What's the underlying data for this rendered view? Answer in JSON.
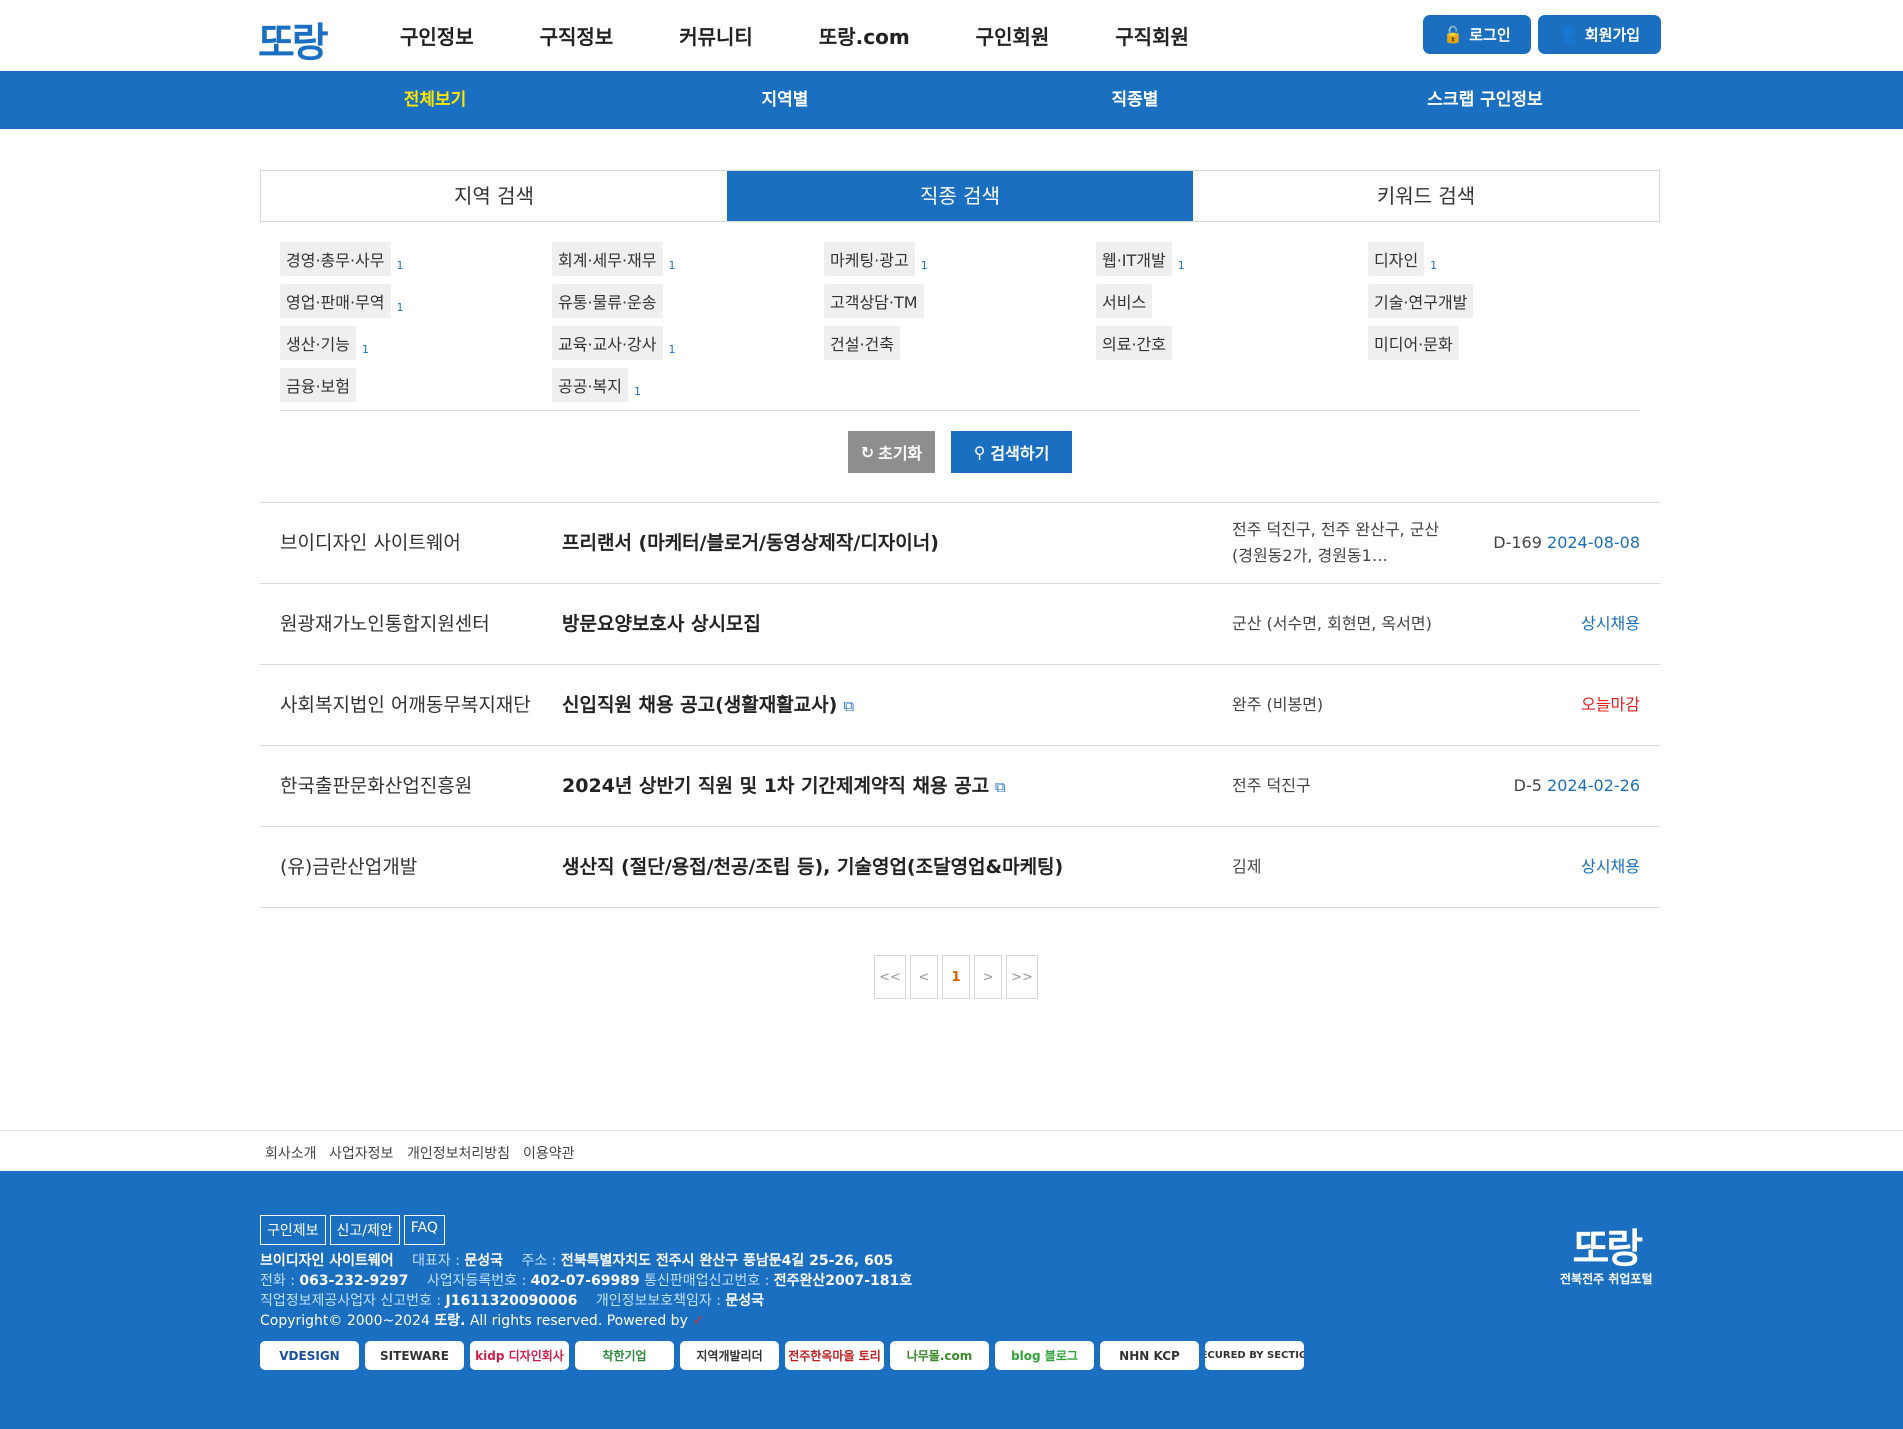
{
  "header": {
    "logo": "또랑",
    "nav": [
      "구인정보",
      "구직정보",
      "커뮤니티",
      "또랑.com",
      "구인회원",
      "구직회원"
    ],
    "login": "로그인",
    "join": "회원가입"
  },
  "subnav": [
    "전체보기",
    "지역별",
    "직종별",
    "스크랩 구인정보"
  ],
  "tabs": [
    "지역 검색",
    "직종 검색",
    "키워드 검색"
  ],
  "categories": [
    {
      "label": "경영·총무·사무",
      "count": "1"
    },
    {
      "label": "회계·세무·재무",
      "count": "1"
    },
    {
      "label": "마케팅·광고",
      "count": "1"
    },
    {
      "label": "웹·IT개발",
      "count": "1"
    },
    {
      "label": "디자인",
      "count": "1"
    },
    {
      "label": "영업·판매·무역",
      "count": "1"
    },
    {
      "label": "유통·물류·운송",
      "count": ""
    },
    {
      "label": "고객상담·TM",
      "count": ""
    },
    {
      "label": "서비스",
      "count": ""
    },
    {
      "label": "기술·연구개발",
      "count": ""
    },
    {
      "label": "생산·기능",
      "count": "1"
    },
    {
      "label": "교육·교사·강사",
      "count": "1"
    },
    {
      "label": "건설·건축",
      "count": ""
    },
    {
      "label": "의료·간호",
      "count": ""
    },
    {
      "label": "미디어·문화",
      "count": ""
    },
    {
      "label": "금융·보험",
      "count": ""
    },
    {
      "label": "공공·복지",
      "count": "1"
    }
  ],
  "buttons": {
    "reset": "초기화",
    "search": "검색하기"
  },
  "jobs": [
    {
      "company": "브이디자인 사이트웨어",
      "title": "프리랜서 (마케터/블로거/동영상제작/디자이너)",
      "location": "전주 덕진구, 전주 완산구, 군산 (경원동2가, 경원동1…",
      "dday": "D-169",
      "date": "2024-08-08",
      "status": ""
    },
    {
      "company": "원광재가노인통합지원센터",
      "title": "방문요양보호사 상시모집",
      "location": "군산 (서수면, 회현면, 옥서면)",
      "dday": "",
      "date": "",
      "status": "상시채용"
    },
    {
      "company": "사회복지법인 어깨동무복지재단",
      "title": "신입직원 채용 공고(생활재활교사)",
      "location": "완주 (비봉면)",
      "dday": "",
      "date": "",
      "status": "오늘마감"
    },
    {
      "company": "한국출판문화산업진흥원",
      "title": "2024년 상반기 직원 및 1차 기간제계약직 채용 공고",
      "location": "전주 덕진구",
      "dday": "D-5",
      "date": "2024-02-26",
      "status": ""
    },
    {
      "company": "(유)금란산업개발",
      "title": "생산직 (절단/용접/천공/조립 등), 기술영업(조달영업&마케팅)",
      "location": "김제",
      "dday": "",
      "date": "",
      "status": "상시채용"
    }
  ],
  "pagination": [
    "<<",
    "<",
    "1",
    ">",
    ">>"
  ],
  "footer_links": [
    "회사소개",
    "사업자정보",
    "개인정보처리방침",
    "이용약관"
  ],
  "footer": {
    "buttons": [
      "구인제보",
      "신고/제안",
      "FAQ"
    ],
    "company": "브이디자인 사이트웨어",
    "ceo_label": "대표자 :",
    "ceo": "문성국",
    "addr_label": "주소 :",
    "addr": "전북특별자치도 전주시 완산구 풍남문4길 25-26, 605",
    "tel_label": "전화 :",
    "tel": "063-232-9297",
    "biz_label": "사업자등록번호 :",
    "biz": "402-07-69989",
    "mail_label": "통신판매업신고번호 :",
    "mail": "전주완산2007-181호",
    "job_label": "직업정보제공사업자 신고번호 :",
    "job": "J1611320090006",
    "priv_label": "개인정보보호책임자 :",
    "priv": "문성국",
    "copyright": "Copyright© 2000~2024",
    "copyright_brand": "또랑.",
    "copyright_tail": "All rights reserved. Powered by",
    "badges": [
      "VDESIGN",
      "SITEWARE",
      "kidp 디자인회사",
      "착한기업",
      "지역개발리더",
      "전주한옥마을 토리",
      "나무몰.com",
      "blog 블로그",
      "NHN KCP",
      "SECURED BY SECTIGO"
    ],
    "logo": "또랑",
    "logo_sub": "전북전주 취업포털"
  }
}
